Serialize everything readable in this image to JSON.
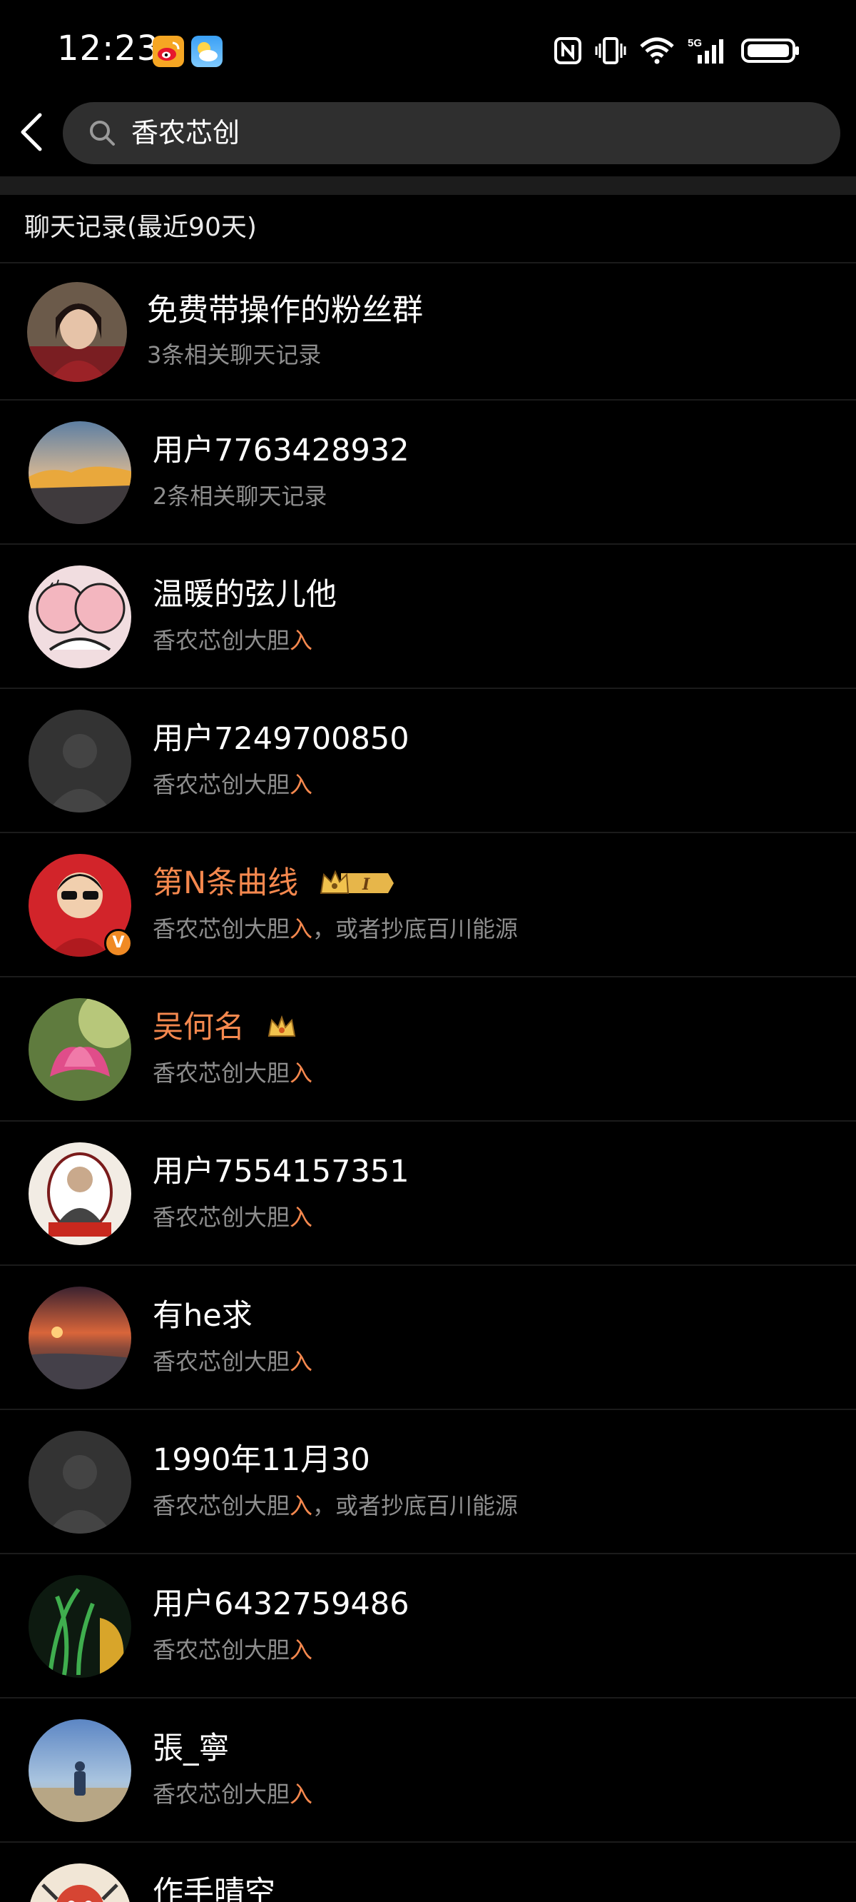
{
  "status_bar": {
    "time": "12:23",
    "icons": [
      "weibo-app-icon",
      "weather-app-icon",
      "nfc-icon",
      "vibrate-icon",
      "wifi-icon",
      "5g-signal-icon",
      "battery-icon"
    ],
    "network_label": "5G"
  },
  "search": {
    "query": "香农芯创",
    "icon": "search-icon",
    "back_icon": "back-arrow-icon"
  },
  "section": {
    "title": "聊天记录(最近90天)"
  },
  "highlight_color": "#f5884e",
  "vip_name_color": "#f5884e",
  "results": [
    {
      "name": "免费带操作的粉丝群",
      "sub": "3条相关聊天记录",
      "sub_hl": "",
      "sub_rest": "",
      "vip": false,
      "avatar": "photo-avatar"
    },
    {
      "name": "用户7763428932",
      "sub": "2条相关聊天记录",
      "sub_hl": "",
      "sub_rest": "",
      "vip": false,
      "avatar": "sunset-mountain-avatar"
    },
    {
      "name": "温暖的弦儿他",
      "sub": "香农芯创大胆",
      "sub_hl": "入",
      "sub_rest": "",
      "vip": false,
      "avatar": "cartoon-avatar"
    },
    {
      "name": "用户7249700850",
      "sub": "香农芯创大胆",
      "sub_hl": "入",
      "sub_rest": "",
      "vip": false,
      "avatar": "default-avatar"
    },
    {
      "name": "第N条曲线",
      "sub": "香农芯创大胆",
      "sub_hl": "入",
      "sub_rest": "，或者抄底百川能源",
      "vip": true,
      "badge": "crown-level-badge",
      "badge_level": "I",
      "verified": "V",
      "avatar": "red-character-avatar"
    },
    {
      "name": "吴何名",
      "sub": "香农芯创大胆",
      "sub_hl": "入",
      "sub_rest": "",
      "vip": true,
      "badge": "crown-badge",
      "avatar": "lotus-avatar"
    },
    {
      "name": "用户7554157351",
      "sub": "香农芯创大胆",
      "sub_hl": "入",
      "sub_rest": "",
      "vip": false,
      "avatar": "portrait-logo-avatar"
    },
    {
      "name": "有he求",
      "sub": "香农芯创大胆",
      "sub_hl": "入",
      "sub_rest": "",
      "vip": false,
      "avatar": "sunset-sea-avatar"
    },
    {
      "name": "1990年11月30",
      "sub": "香农芯创大胆",
      "sub_hl": "入",
      "sub_rest": "，或者抄底百川能源",
      "vip": false,
      "avatar": "default-avatar"
    },
    {
      "name": "用户6432759486",
      "sub": "香农芯创大胆",
      "sub_hl": "入",
      "sub_rest": "",
      "vip": false,
      "avatar": "green-plant-avatar"
    },
    {
      "name": "張_寧",
      "sub": "香农芯创大胆",
      "sub_hl": "入",
      "sub_rest": "",
      "vip": false,
      "avatar": "beach-person-avatar"
    },
    {
      "name": "作手晴空",
      "sub": "",
      "sub_hl": "",
      "sub_rest": "",
      "vip": false,
      "avatar": "cartoon-red-avatar"
    }
  ]
}
